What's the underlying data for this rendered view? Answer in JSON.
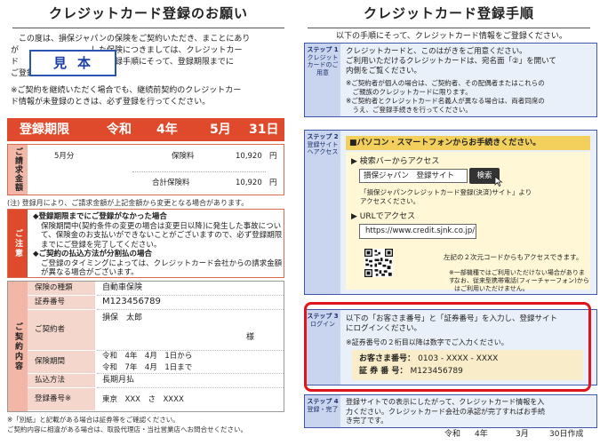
{
  "left": {
    "title": "クレジットカード登録のお願い",
    "intro_lines": [
      "　この度は、損保ジャパンの保険をご契約いただき、まことにあり",
      "が　　　　　　　　　した保険につきましては、クレジットカー",
      "ド　　　　　　　　　記の登録手順にそって、登録期限までに",
      "ご登録をお願いいたします。",
      "※ご契約を継続いただく場合でも、継続前契約のクレジットカー",
      "ド情報が未登録のときは、必ず登録を行ってください。"
    ],
    "stamp": "見本",
    "deadline": {
      "label": "登録期限",
      "era": "令和",
      "year": "4年",
      "month": "5月",
      "day": "31日"
    },
    "billing": {
      "tag": "ご請求金額",
      "row1_month": "5月分",
      "row1_label": "保険料",
      "row1_amount": "10,920",
      "row1_unit": "円",
      "row2_label": "合計保険料",
      "row2_amount": "10,920",
      "row2_unit": "円"
    },
    "billing_note": "(注) 登録月により、ご請求金額が上記金額から変更となる場合があります。",
    "caution": {
      "tag": "ご注意",
      "item1_head": "◆登録期限までにご登録がなかった場合",
      "item1_body": "保険期間中(契約条件の変更の場合は変更日以降)に発生した事故について、保険金のお支払いができないことがございますので、必ず登録期限までにご登録を完了してください。",
      "item2_head": "◆ご契約の払込方法が分割払の場合",
      "item2_body": "ご登録のタイミングによっては、クレジットカード会社からの請求金額が異なる場合がございます。"
    },
    "contract": {
      "tag": "ご契約内容",
      "rows": [
        {
          "label": "保険の種類",
          "value": "自動車保険"
        },
        {
          "label": "証券番号",
          "value": "M123456789"
        },
        {
          "label": "ご契約者",
          "value": "損保　太郎",
          "suffix": "様"
        },
        {
          "label": "保険期間",
          "value": "令和　4年　4月　1日から",
          "value2": "令和　7年　4月　1日まで"
        },
        {
          "label": "払込方法",
          "value": "長期月払"
        },
        {
          "label": "登録番号※",
          "value": "東京　XXX　さ　XXXX"
        }
      ]
    },
    "footnotes": [
      "※「別紙」と記載がある場合は証券等をご確認ください。",
      "ご契約内容に相違がある場合は、取扱代理店・当社営業店へお問合せください。"
    ]
  },
  "right": {
    "title": "クレジットカード登録手順",
    "subtitle": "以下の手順にそって、クレジットカード情報をご登録ください。",
    "step1": {
      "label_num": "ステップ 1",
      "label_text": "クレジットカードのご用意",
      "lines": [
        "クレジットカードと、このはがきをご用意ください。",
        "ご利用いただけるクレジットカードは、宛名面「②」を開いて",
        "内側をご覧ください。",
        "※ご契約者が個人の場合は、ご契約者、その配偶者またはこれらの",
        "　ご親族のクレジットカードに限ります。",
        "※ご契約者とクレジットカード名義人が異なる場合は、両者同席の",
        "　うえ、ご登録手続きを行ってください。"
      ]
    },
    "step2": {
      "label_num": "ステップ 2",
      "label_text": "登録サイトへアクセス",
      "bar": "■パソコン・スマートフォンからお手続きください。",
      "search_head": "▶ 検索バーからアクセス",
      "search_value": "損保ジャパン　登録サイト",
      "search_button": "検索",
      "search_note1": "「損保ジャパンクレジットカード登録(決済)サイト」より",
      "search_note2": "アクセスください。",
      "url_head": "▶ URLでアクセス",
      "url": "https://www.credit.sjnk.co.jp/",
      "qr_note": "左記の２次元コードからもアクセスできます。",
      "mobile_note1": "※一部機種ではご利用いただけない場合があります。",
      "mobile_note2": "なお、従来型携帯電話(フィーチャーフォン)から",
      "mobile_note3": "はご利用いただけません。"
    },
    "step3": {
      "label_num": "ステップ 3",
      "label_text": "ログイン",
      "line1": "以下の「お客さま番号」と「証券番号」を入力し、登録サイト",
      "line2": "にログインください。",
      "line3": "※証券番号の２桁目以降は数字でご入力ください。",
      "customer_label": "お客さま番号：",
      "customer_value": "0103 - XXXX - XXXX",
      "policy_label": "証 券 番 号：",
      "policy_value": "M123456789"
    },
    "step4": {
      "label_num": "ステップ 4",
      "label_text": "登録・完了",
      "line1": "登録サイトでの表示にしたがって、クレジットカード情報を入",
      "line2": "力ください。クレジットカード会社の承認が完了すればお手続",
      "line3": "き完了です。"
    },
    "date": {
      "era": "令和",
      "year": "4年",
      "month": "3月",
      "day": "30日作成"
    }
  },
  "colors": {
    "deadline_red": "#e04a2c",
    "step_blue": "#3f59a8",
    "highlight_red": "#e0141c",
    "stamp_blue": "#1a3fa6"
  }
}
